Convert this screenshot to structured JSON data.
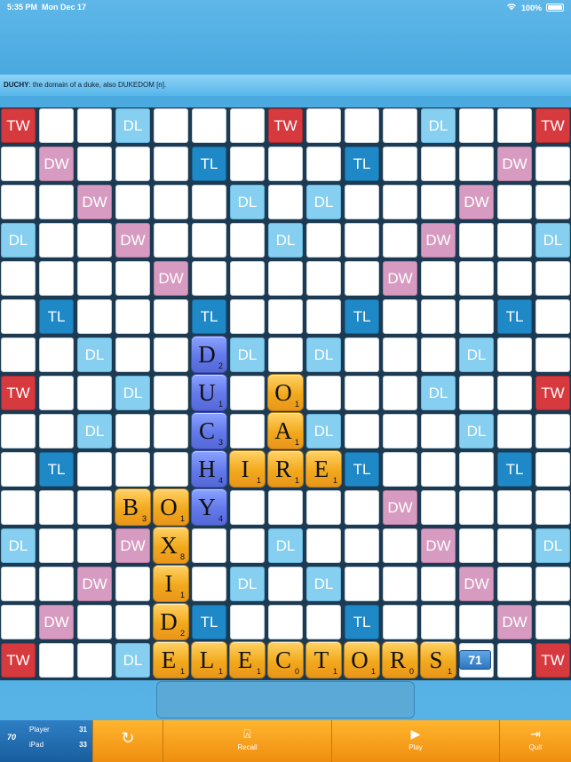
{
  "status": {
    "time": "5:35 PM",
    "date": "Mon Dec 17",
    "battery": "100%"
  },
  "definition": {
    "word": "DUCHY",
    "text": ": the domain of a duke, also DUKEDOM [n]."
  },
  "board": {
    "premium_rows": [
      [
        "TW",
        "",
        "",
        "DL",
        "",
        "",
        "",
        "TW",
        "",
        "",
        "",
        "DL",
        "",
        "",
        "TW"
      ],
      [
        "",
        "DW",
        "",
        "",
        "",
        "TL",
        "",
        "",
        "",
        "TL",
        "",
        "",
        "",
        "DW",
        ""
      ],
      [
        "",
        "",
        "DW",
        "",
        "",
        "",
        "DL",
        "",
        "DL",
        "",
        "",
        "",
        "DW",
        "",
        ""
      ],
      [
        "DL",
        "",
        "",
        "DW",
        "",
        "",
        "",
        "DL",
        "",
        "",
        "",
        "DW",
        "",
        "",
        "DL"
      ],
      [
        "",
        "",
        "",
        "",
        "DW",
        "",
        "",
        "",
        "",
        "",
        "DW",
        "",
        "",
        "",
        ""
      ],
      [
        "",
        "TL",
        "",
        "",
        "",
        "TL",
        "",
        "",
        "",
        "TL",
        "",
        "",
        "",
        "TL",
        ""
      ],
      [
        "",
        "",
        "DL",
        "",
        "",
        "",
        "DL",
        "",
        "DL",
        "",
        "",
        "",
        "DL",
        "",
        ""
      ],
      [
        "TW",
        "",
        "",
        "DL",
        "",
        "",
        "",
        "",
        "",
        "",
        "",
        "DL",
        "",
        "",
        "TW"
      ],
      [
        "",
        "",
        "DL",
        "",
        "",
        "",
        "",
        "",
        "DL",
        "",
        "",
        "",
        "DL",
        "",
        ""
      ],
      [
        "",
        "TL",
        "",
        "",
        "",
        "",
        "",
        "",
        "",
        "TL",
        "",
        "",
        "",
        "TL",
        ""
      ],
      [
        "",
        "",
        "",
        "",
        "",
        "",
        "",
        "",
        "",
        "",
        "DW",
        "",
        "",
        "",
        ""
      ],
      [
        "DL",
        "",
        "",
        "DW",
        "",
        "",
        "",
        "DL",
        "",
        "",
        "",
        "DW",
        "",
        "",
        "DL"
      ],
      [
        "",
        "",
        "DW",
        "",
        "",
        "",
        "DL",
        "",
        "DL",
        "",
        "",
        "",
        "DW",
        "",
        ""
      ],
      [
        "",
        "DW",
        "",
        "",
        "",
        "TL",
        "",
        "",
        "",
        "TL",
        "",
        "",
        "",
        "DW",
        ""
      ],
      [
        "TW",
        "",
        "",
        "DL",
        "",
        "",
        "",
        "",
        "",
        "",
        "",
        "",
        "",
        "",
        "TW"
      ]
    ],
    "tiles": [
      {
        "row": 6,
        "col": 5,
        "letter": "D",
        "points": "2",
        "color": "blue"
      },
      {
        "row": 7,
        "col": 5,
        "letter": "U",
        "points": "1",
        "color": "blue"
      },
      {
        "row": 8,
        "col": 5,
        "letter": "C",
        "points": "3",
        "color": "blue"
      },
      {
        "row": 9,
        "col": 5,
        "letter": "H",
        "points": "4",
        "color": "blue"
      },
      {
        "row": 10,
        "col": 5,
        "letter": "Y",
        "points": "4",
        "color": "blue"
      },
      {
        "row": 7,
        "col": 7,
        "letter": "O",
        "points": "1",
        "color": "orange"
      },
      {
        "row": 8,
        "col": 7,
        "letter": "A",
        "points": "1",
        "color": "orange"
      },
      {
        "row": 9,
        "col": 6,
        "letter": "I",
        "points": "1",
        "color": "orange"
      },
      {
        "row": 9,
        "col": 7,
        "letter": "R",
        "points": "1",
        "color": "orange"
      },
      {
        "row": 9,
        "col": 8,
        "letter": "E",
        "points": "1",
        "color": "orange"
      },
      {
        "row": 10,
        "col": 3,
        "letter": "B",
        "points": "3",
        "color": "orange"
      },
      {
        "row": 10,
        "col": 4,
        "letter": "O",
        "points": "1",
        "color": "orange"
      },
      {
        "row": 11,
        "col": 4,
        "letter": "X",
        "points": "8",
        "color": "orange"
      },
      {
        "row": 12,
        "col": 4,
        "letter": "I",
        "points": "1",
        "color": "orange"
      },
      {
        "row": 13,
        "col": 4,
        "letter": "D",
        "points": "2",
        "color": "orange"
      },
      {
        "row": 14,
        "col": 4,
        "letter": "E",
        "points": "1",
        "color": "orange"
      },
      {
        "row": 14,
        "col": 5,
        "letter": "L",
        "points": "1",
        "color": "orange"
      },
      {
        "row": 14,
        "col": 6,
        "letter": "E",
        "points": "1",
        "color": "orange"
      },
      {
        "row": 14,
        "col": 7,
        "letter": "C",
        "points": "0",
        "color": "orange"
      },
      {
        "row": 14,
        "col": 8,
        "letter": "T",
        "points": "1",
        "color": "orange"
      },
      {
        "row": 14,
        "col": 9,
        "letter": "O",
        "points": "1",
        "color": "orange"
      },
      {
        "row": 14,
        "col": 10,
        "letter": "R",
        "points": "0",
        "color": "orange"
      },
      {
        "row": 14,
        "col": 11,
        "letter": "S",
        "points": "1",
        "color": "orange"
      }
    ],
    "move_score": "71"
  },
  "scores": {
    "level": "70",
    "player_label": "Player",
    "player_score": "31",
    "ipad_label": "iPad",
    "ipad_score": "33"
  },
  "buttons": {
    "recall": "Recall",
    "play": "Play",
    "quit": "Quit"
  },
  "icons": {
    "shuffle": "refresh-icon",
    "recall": "recall-icon",
    "play": "play-icon",
    "quit": "exit-icon"
  },
  "colors": {
    "tw": "#d63a3f",
    "dw": "#d79bc1",
    "tl": "#1f89c7",
    "dl": "#86cff0",
    "tile": "#f2a91c",
    "tile_blue": "#6378ea"
  }
}
